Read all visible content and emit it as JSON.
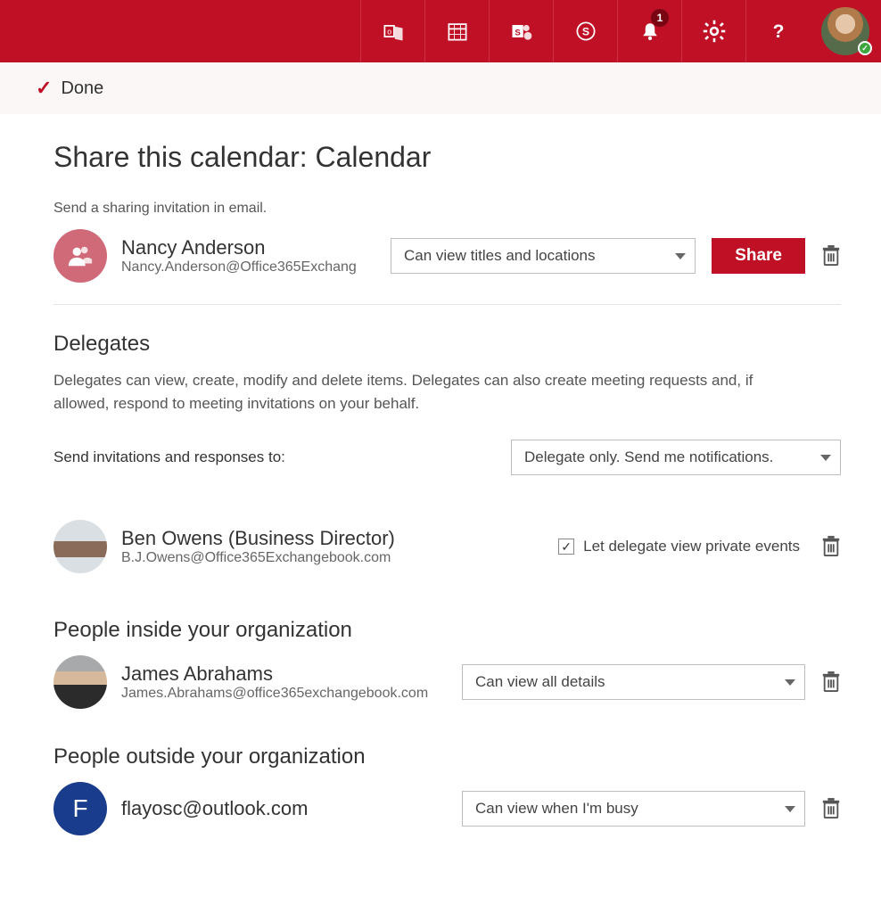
{
  "header": {
    "notifications_count": "1"
  },
  "done_bar": {
    "label": "Done"
  },
  "page": {
    "title": "Share this calendar: Calendar",
    "invite_subtext": "Send a sharing invitation in email."
  },
  "invite": {
    "name": "Nancy Anderson",
    "email": "Nancy.Anderson@Office365Exchang",
    "permission": "Can view titles and locations",
    "share_button": "Share"
  },
  "delegates": {
    "heading": "Delegates",
    "description": "Delegates can view, create, modify and delete items. Delegates can also create meeting requests and, if allowed, respond to meeting invitations on your behalf.",
    "send_label": "Send invitations and responses to:",
    "send_value": "Delegate only. Send me notifications.",
    "checkbox_label": "Let delegate view private events",
    "people": [
      {
        "name": "Ben Owens (Business Director)",
        "email": "B.J.Owens@Office365Exchangebook.com",
        "checked": true
      }
    ]
  },
  "inside": {
    "heading": "People inside your organization",
    "people": [
      {
        "name": "James Abrahams",
        "email": "James.Abrahams@office365exchangebook.com",
        "permission": "Can view all details"
      }
    ]
  },
  "outside": {
    "heading": "People outside your organization",
    "people": [
      {
        "initial": "F",
        "email": "flayosc@outlook.com",
        "permission": "Can view when I'm busy"
      }
    ]
  }
}
